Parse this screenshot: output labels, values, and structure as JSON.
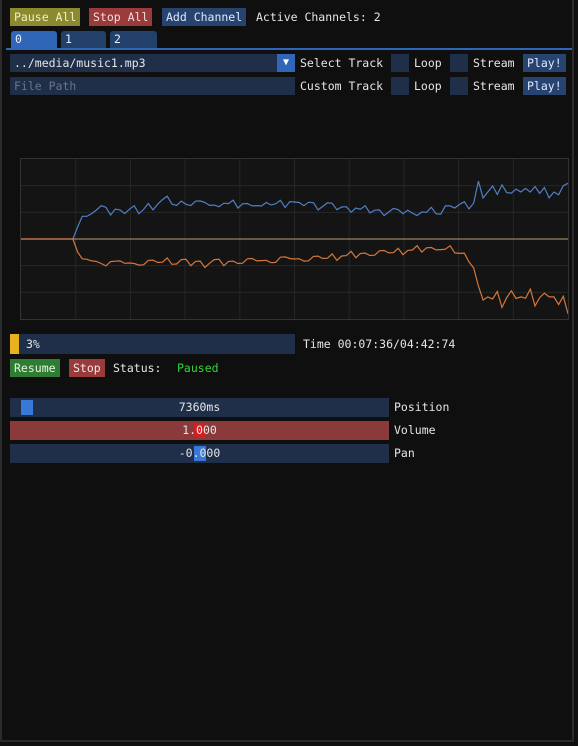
{
  "toolbar": {
    "pause_all": "Pause All",
    "stop_all": "Stop All",
    "add_channel": "Add Channel",
    "active_channels": "Active Channels: 2"
  },
  "tabs": [
    "0",
    "1",
    "2"
  ],
  "track": {
    "selected_path": "../media/music1.mp3",
    "select_track_label": "Select Track",
    "file_path_placeholder": "File Path",
    "custom_track_label": "Custom Track",
    "loop_label": "Loop",
    "stream_label": "Stream",
    "play_label": "Play!"
  },
  "chart_data": {
    "type": "line",
    "title": "",
    "xlabel": "",
    "ylabel": "",
    "ylim": [
      -1,
      1
    ],
    "grid": true,
    "series": [
      {
        "color": "#4f7fc6",
        "values": [
          0.0,
          0.0,
          0.0,
          0.0,
          0.0,
          0.0,
          0.0,
          0.0,
          0.0,
          0.0,
          0.0,
          0.0,
          0.15,
          0.26,
          0.32,
          0.33,
          0.35,
          0.38,
          0.42,
          0.3,
          0.35,
          0.4,
          0.33,
          0.36,
          0.38,
          0.34,
          0.37,
          0.42,
          0.4,
          0.45,
          0.48,
          0.5,
          0.46,
          0.42,
          0.45,
          0.47,
          0.43,
          0.46,
          0.44,
          0.48,
          0.42,
          0.4,
          0.44,
          0.46,
          0.43,
          0.45,
          0.41,
          0.44,
          0.42,
          0.45,
          0.43,
          0.4,
          0.42,
          0.45,
          0.44,
          0.46,
          0.43,
          0.48,
          0.45,
          0.42,
          0.44,
          0.46,
          0.43,
          0.4,
          0.42,
          0.44,
          0.41,
          0.39,
          0.4,
          0.38,
          0.37,
          0.4,
          0.36,
          0.38,
          0.35,
          0.36,
          0.34,
          0.33,
          0.35,
          0.37,
          0.33,
          0.34,
          0.36,
          0.3,
          0.33,
          0.35,
          0.32,
          0.36,
          0.34,
          0.31,
          0.39,
          0.45,
          0.4,
          0.42,
          0.43,
          0.4,
          0.45,
          0.7,
          0.55,
          0.6,
          0.65,
          0.52,
          0.7,
          0.58,
          0.55,
          0.66,
          0.6,
          0.62,
          0.55,
          0.68,
          0.57,
          0.62,
          0.55,
          0.6,
          0.54,
          0.63,
          0.72
        ]
      },
      {
        "color": "#d6763a",
        "values": [
          0.0,
          0.0,
          0.0,
          0.0,
          0.0,
          0.0,
          0.0,
          0.0,
          0.0,
          0.0,
          0.0,
          0.0,
          -0.15,
          -0.26,
          -0.29,
          -0.25,
          -0.28,
          -0.33,
          -0.3,
          -0.27,
          -0.29,
          -0.31,
          -0.28,
          -0.3,
          -0.33,
          -0.29,
          -0.31,
          -0.28,
          -0.3,
          -0.27,
          -0.29,
          -0.26,
          -0.28,
          -0.3,
          -0.27,
          -0.29,
          -0.31,
          -0.28,
          -0.3,
          -0.32,
          -0.29,
          -0.27,
          -0.29,
          -0.31,
          -0.28,
          -0.3,
          -0.27,
          -0.29,
          -0.26,
          -0.28,
          -0.25,
          -0.27,
          -0.29,
          -0.26,
          -0.28,
          -0.24,
          -0.26,
          -0.22,
          -0.25,
          -0.27,
          -0.24,
          -0.26,
          -0.23,
          -0.25,
          -0.22,
          -0.24,
          -0.21,
          -0.23,
          -0.2,
          -0.22,
          -0.19,
          -0.21,
          -0.18,
          -0.2,
          -0.17,
          -0.19,
          -0.16,
          -0.18,
          -0.15,
          -0.17,
          -0.14,
          -0.16,
          -0.13,
          -0.15,
          -0.12,
          -0.14,
          -0.11,
          -0.13,
          -0.1,
          -0.12,
          -0.14,
          -0.12,
          -0.15,
          -0.18,
          -0.2,
          -0.25,
          -0.35,
          -0.6,
          -0.8,
          -0.7,
          -0.75,
          -0.68,
          -0.82,
          -0.72,
          -0.66,
          -0.78,
          -0.7,
          -0.74,
          -0.65,
          -0.8,
          -0.72,
          -0.69,
          -0.76,
          -0.7,
          -0.82,
          -0.74,
          -0.9
        ]
      }
    ]
  },
  "playback": {
    "progress_fraction": 0.03,
    "progress_text": "3%",
    "time_text": "Time 00:07:36/04:42:74",
    "resume_label": "Resume",
    "stop_label": "Stop",
    "status_label": "Status:",
    "status_value": "Paused",
    "status_color": "#2fd63a"
  },
  "sliders": {
    "position": {
      "text": "7360ms",
      "label": "Position",
      "fraction": 0.03
    },
    "volume": {
      "text": "1.000",
      "label": "Volume",
      "fraction": 0.5
    },
    "pan": {
      "text": "-0.000",
      "label": "Pan",
      "fraction": 0.5
    }
  }
}
